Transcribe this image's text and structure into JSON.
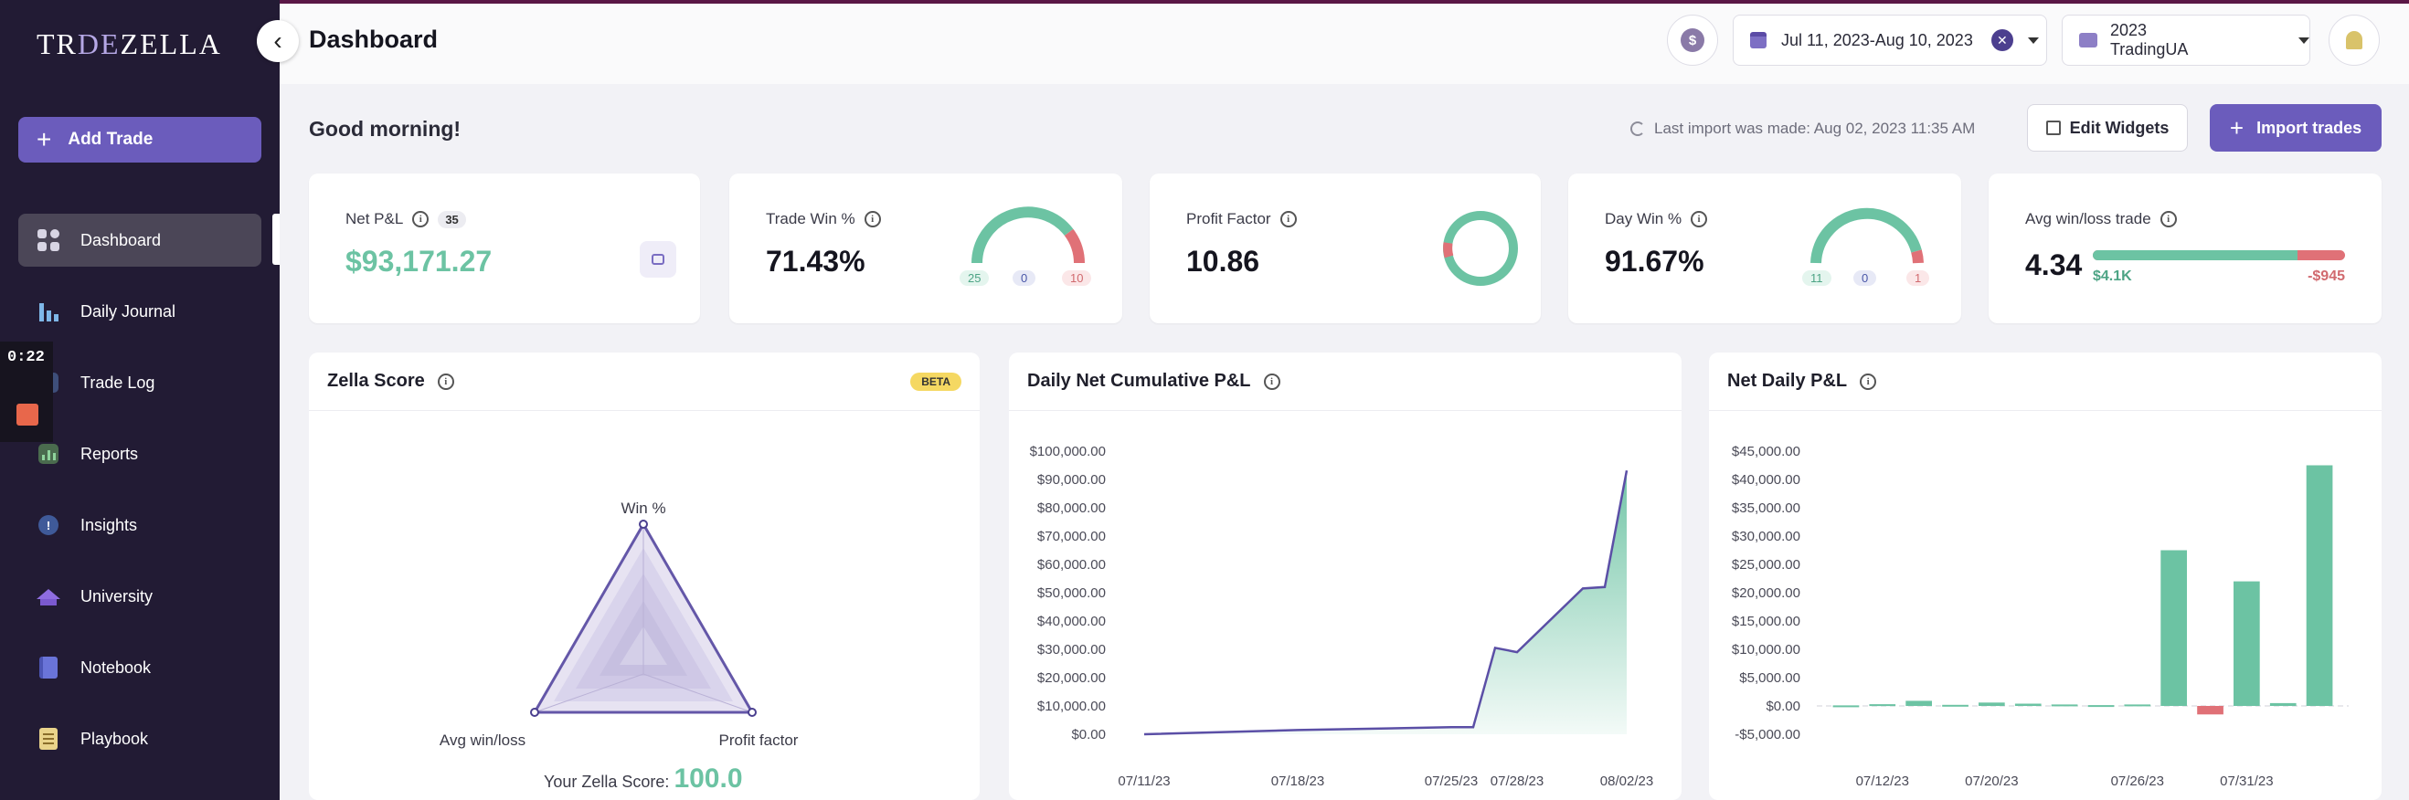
{
  "brand": {
    "logo_a": "TR",
    "logo_b": "DE",
    "logo_c": "ZELLA"
  },
  "header": {
    "title": "Dashboard",
    "date_range": "Jul 11, 2023-Aug 10, 2023",
    "account": "2023 TradingUA"
  },
  "sidebar": {
    "add_trade": "Add Trade",
    "items": [
      {
        "label": "Dashboard",
        "icon": "dashboard-icon"
      },
      {
        "label": "Daily Journal",
        "icon": "journal-icon"
      },
      {
        "label": "Trade Log",
        "icon": "trade-log-icon"
      },
      {
        "label": "Reports",
        "icon": "reports-icon"
      },
      {
        "label": "Insights",
        "icon": "insights-icon"
      },
      {
        "label": "University",
        "icon": "university-icon"
      },
      {
        "label": "Notebook",
        "icon": "notebook-icon"
      },
      {
        "label": "Playbook",
        "icon": "playbook-icon"
      }
    ]
  },
  "recording": {
    "time": "0:22"
  },
  "toolbar": {
    "greeting": "Good morning!",
    "last_import": "Last import was made: Aug 02, 2023 11:35 AM",
    "edit_widgets": "Edit Widgets",
    "import_trades": "Import trades"
  },
  "kpis": {
    "net_pnl": {
      "label": "Net P&L",
      "count": "35",
      "value": "$93,171.27"
    },
    "trade_win": {
      "label": "Trade Win %",
      "value": "71.43%",
      "wins": "25",
      "breakeven": "0",
      "losses": "10"
    },
    "profit_factor": {
      "label": "Profit Factor",
      "value": "10.86"
    },
    "day_win": {
      "label": "Day Win %",
      "value": "91.67%",
      "wins": "11",
      "breakeven": "0",
      "losses": "1"
    },
    "avg_win_loss": {
      "label": "Avg win/loss trade",
      "value": "4.34",
      "avg_win": "$4.1K",
      "avg_loss": "-$945",
      "win_share": 0.81
    }
  },
  "colors": {
    "accent": "#6b5cbc",
    "green": "#6cc3a3",
    "red": "#e07177",
    "sidebar": "#221b34"
  },
  "panels": {
    "zella": {
      "title": "Zella Score",
      "badge": "BETA",
      "score_label": "Your Zella Score:",
      "score": "100.0",
      "axes": [
        "Win %",
        "Profit factor",
        "Avg win/loss"
      ]
    },
    "cumulative": {
      "title": "Daily Net Cumulative P&L"
    },
    "daily": {
      "title": "Net Daily P&L"
    }
  },
  "chart_data": [
    {
      "type": "area",
      "title": "Daily Net Cumulative P&L",
      "x_ticks": [
        "07/11/23",
        "07/18/23",
        "07/25/23",
        "07/28/23",
        "08/02/23"
      ],
      "y_ticks": [
        "$100,000.00",
        "$90,000.00",
        "$80,000.00",
        "$70,000.00",
        "$60,000.00",
        "$50,000.00",
        "$40,000.00",
        "$30,000.00",
        "$20,000.00",
        "$10,000.00",
        "$0.00"
      ],
      "ylim": [
        0,
        100000
      ],
      "x": [
        "07/11/23",
        "07/18/23",
        "07/25/23",
        "07/26/23",
        "07/27/23",
        "07/28/23",
        "07/31/23",
        "08/01/23",
        "08/02/23"
      ],
      "values": [
        0,
        1500,
        2500,
        2500,
        30500,
        29000,
        51500,
        52000,
        93171
      ],
      "grid": false
    },
    {
      "type": "bar",
      "title": "Net Daily P&L",
      "x_ticks": [
        "07/12/23",
        "07/20/23",
        "07/26/23",
        "07/31/23"
      ],
      "y_ticks": [
        "$45,000.00",
        "$40,000.00",
        "$35,000.00",
        "$30,000.00",
        "$25,000.00",
        "$20,000.00",
        "$15,000.00",
        "$10,000.00",
        "$5,000.00",
        "$0.00",
        "-$5,000.00"
      ],
      "ylim": [
        -5000,
        45000
      ],
      "values": [
        100,
        300,
        900,
        200,
        600,
        400,
        250,
        150,
        250,
        27500,
        -1500,
        22000,
        500,
        42500
      ],
      "colors_by_sign": {
        "positive": "#6cc3a3",
        "negative": "#e07177"
      }
    },
    {
      "type": "radar",
      "title": "Zella Score",
      "axes": [
        "Win %",
        "Profit factor",
        "Avg win/loss"
      ],
      "values": [
        100,
        100,
        100
      ],
      "max": 100
    }
  ]
}
